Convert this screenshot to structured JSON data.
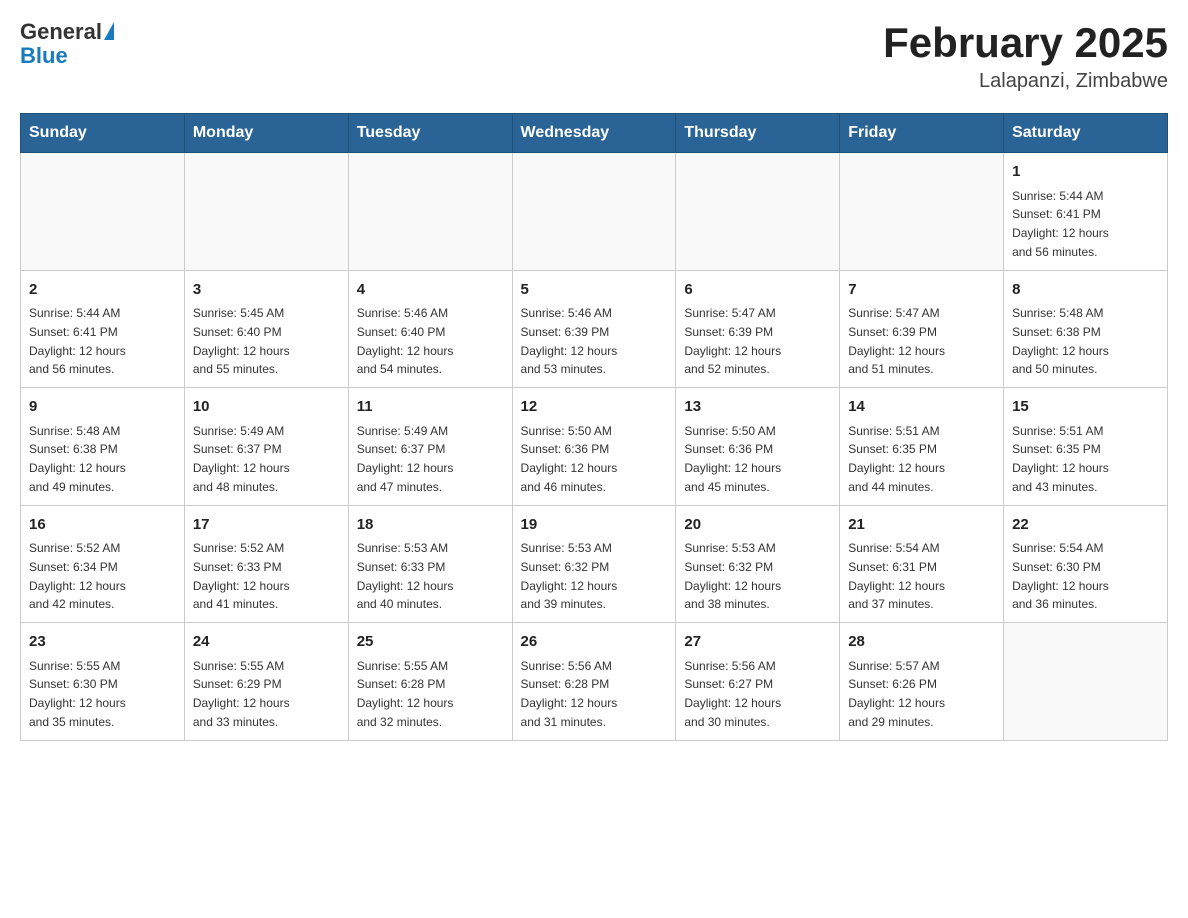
{
  "header": {
    "logo": {
      "general": "General",
      "blue": "Blue"
    },
    "title": "February 2025",
    "subtitle": "Lalapanzi, Zimbabwe"
  },
  "days_of_week": [
    "Sunday",
    "Monday",
    "Tuesday",
    "Wednesday",
    "Thursday",
    "Friday",
    "Saturday"
  ],
  "weeks": [
    [
      {
        "day": "",
        "info": ""
      },
      {
        "day": "",
        "info": ""
      },
      {
        "day": "",
        "info": ""
      },
      {
        "day": "",
        "info": ""
      },
      {
        "day": "",
        "info": ""
      },
      {
        "day": "",
        "info": ""
      },
      {
        "day": "1",
        "info": "Sunrise: 5:44 AM\nSunset: 6:41 PM\nDaylight: 12 hours\nand 56 minutes."
      }
    ],
    [
      {
        "day": "2",
        "info": "Sunrise: 5:44 AM\nSunset: 6:41 PM\nDaylight: 12 hours\nand 56 minutes."
      },
      {
        "day": "3",
        "info": "Sunrise: 5:45 AM\nSunset: 6:40 PM\nDaylight: 12 hours\nand 55 minutes."
      },
      {
        "day": "4",
        "info": "Sunrise: 5:46 AM\nSunset: 6:40 PM\nDaylight: 12 hours\nand 54 minutes."
      },
      {
        "day": "5",
        "info": "Sunrise: 5:46 AM\nSunset: 6:39 PM\nDaylight: 12 hours\nand 53 minutes."
      },
      {
        "day": "6",
        "info": "Sunrise: 5:47 AM\nSunset: 6:39 PM\nDaylight: 12 hours\nand 52 minutes."
      },
      {
        "day": "7",
        "info": "Sunrise: 5:47 AM\nSunset: 6:39 PM\nDaylight: 12 hours\nand 51 minutes."
      },
      {
        "day": "8",
        "info": "Sunrise: 5:48 AM\nSunset: 6:38 PM\nDaylight: 12 hours\nand 50 minutes."
      }
    ],
    [
      {
        "day": "9",
        "info": "Sunrise: 5:48 AM\nSunset: 6:38 PM\nDaylight: 12 hours\nand 49 minutes."
      },
      {
        "day": "10",
        "info": "Sunrise: 5:49 AM\nSunset: 6:37 PM\nDaylight: 12 hours\nand 48 minutes."
      },
      {
        "day": "11",
        "info": "Sunrise: 5:49 AM\nSunset: 6:37 PM\nDaylight: 12 hours\nand 47 minutes."
      },
      {
        "day": "12",
        "info": "Sunrise: 5:50 AM\nSunset: 6:36 PM\nDaylight: 12 hours\nand 46 minutes."
      },
      {
        "day": "13",
        "info": "Sunrise: 5:50 AM\nSunset: 6:36 PM\nDaylight: 12 hours\nand 45 minutes."
      },
      {
        "day": "14",
        "info": "Sunrise: 5:51 AM\nSunset: 6:35 PM\nDaylight: 12 hours\nand 44 minutes."
      },
      {
        "day": "15",
        "info": "Sunrise: 5:51 AM\nSunset: 6:35 PM\nDaylight: 12 hours\nand 43 minutes."
      }
    ],
    [
      {
        "day": "16",
        "info": "Sunrise: 5:52 AM\nSunset: 6:34 PM\nDaylight: 12 hours\nand 42 minutes."
      },
      {
        "day": "17",
        "info": "Sunrise: 5:52 AM\nSunset: 6:33 PM\nDaylight: 12 hours\nand 41 minutes."
      },
      {
        "day": "18",
        "info": "Sunrise: 5:53 AM\nSunset: 6:33 PM\nDaylight: 12 hours\nand 40 minutes."
      },
      {
        "day": "19",
        "info": "Sunrise: 5:53 AM\nSunset: 6:32 PM\nDaylight: 12 hours\nand 39 minutes."
      },
      {
        "day": "20",
        "info": "Sunrise: 5:53 AM\nSunset: 6:32 PM\nDaylight: 12 hours\nand 38 minutes."
      },
      {
        "day": "21",
        "info": "Sunrise: 5:54 AM\nSunset: 6:31 PM\nDaylight: 12 hours\nand 37 minutes."
      },
      {
        "day": "22",
        "info": "Sunrise: 5:54 AM\nSunset: 6:30 PM\nDaylight: 12 hours\nand 36 minutes."
      }
    ],
    [
      {
        "day": "23",
        "info": "Sunrise: 5:55 AM\nSunset: 6:30 PM\nDaylight: 12 hours\nand 35 minutes."
      },
      {
        "day": "24",
        "info": "Sunrise: 5:55 AM\nSunset: 6:29 PM\nDaylight: 12 hours\nand 33 minutes."
      },
      {
        "day": "25",
        "info": "Sunrise: 5:55 AM\nSunset: 6:28 PM\nDaylight: 12 hours\nand 32 minutes."
      },
      {
        "day": "26",
        "info": "Sunrise: 5:56 AM\nSunset: 6:28 PM\nDaylight: 12 hours\nand 31 minutes."
      },
      {
        "day": "27",
        "info": "Sunrise: 5:56 AM\nSunset: 6:27 PM\nDaylight: 12 hours\nand 30 minutes."
      },
      {
        "day": "28",
        "info": "Sunrise: 5:57 AM\nSunset: 6:26 PM\nDaylight: 12 hours\nand 29 minutes."
      },
      {
        "day": "",
        "info": ""
      }
    ]
  ]
}
